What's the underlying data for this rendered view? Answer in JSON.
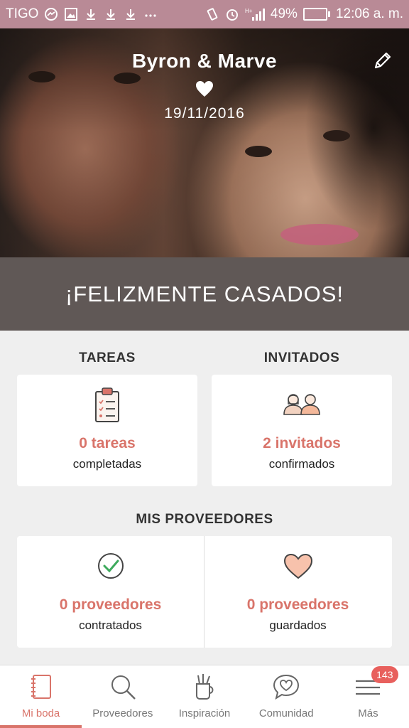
{
  "status_bar": {
    "carrier": "TIGO",
    "signal_network": "H+",
    "battery_percent": "49%",
    "battery_level": 0.49,
    "time": "12:06 a. m.",
    "icons": [
      "messenger-icon",
      "image-icon",
      "download-icon",
      "download-icon",
      "download-icon",
      "more-icon",
      "vibrate-icon",
      "alarm-icon",
      "signal-icon",
      "battery-charging-icon"
    ]
  },
  "hero": {
    "couple_names": "Byron & Marve",
    "wedding_date": "19/11/2016",
    "icons": {
      "heart": "heart-icon",
      "edit": "edit-pencil-icon"
    }
  },
  "banner": {
    "text": "¡FELIZMENTE CASADOS!"
  },
  "tareas": {
    "title": "TAREAS",
    "value": "0 tareas",
    "subtitle": "completadas",
    "icon": "clipboard-checklist-icon"
  },
  "invitados": {
    "title": "INVITADOS",
    "value": "2 invitados",
    "subtitle": "confirmados",
    "icon": "guests-icon"
  },
  "proveedores": {
    "title": "MIS PROVEEDORES",
    "contratados": {
      "value": "0 proveedores",
      "subtitle": "contratados",
      "icon": "check-circle-icon"
    },
    "guardados": {
      "value": "0 proveedores",
      "subtitle": "guardados",
      "icon": "heart-outline-icon"
    }
  },
  "nav": {
    "items": [
      {
        "label": "Mi boda",
        "icon": "notebook-icon",
        "active": true
      },
      {
        "label": "Proveedores",
        "icon": "search-icon"
      },
      {
        "label": "Inspiración",
        "icon": "pencil-cup-icon"
      },
      {
        "label": "Comunidad",
        "icon": "chat-heart-icon"
      },
      {
        "label": "Más",
        "icon": "menu-icon",
        "badge": "143"
      }
    ]
  },
  "colors": {
    "accent": "#d9746a",
    "status_bar": "#b98a96",
    "banner": "#605856",
    "background": "#efefef"
  }
}
